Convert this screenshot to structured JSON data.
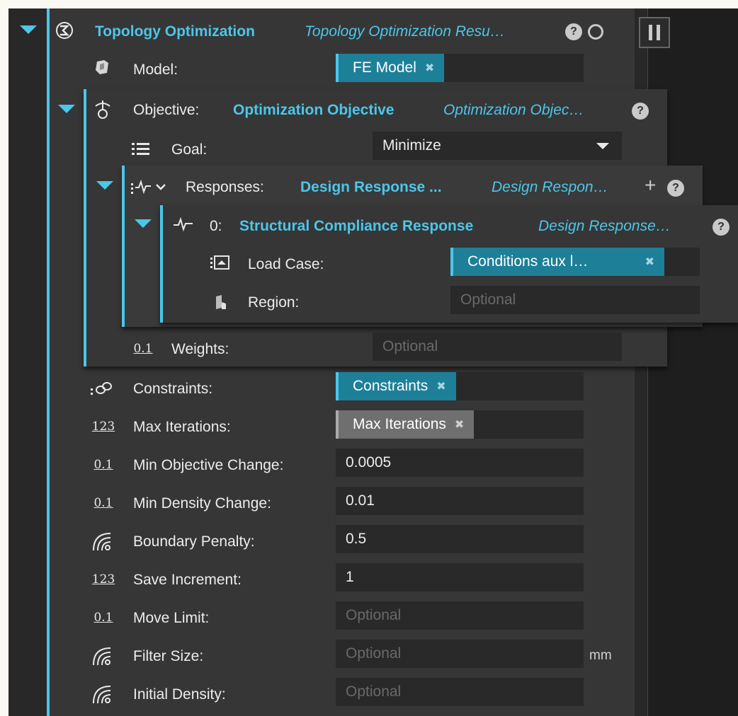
{
  "root": {
    "title": "Topology Optimization",
    "type": "Topology Optimization Resu…",
    "help_icon": "help-icon",
    "status_icon": "circle-icon",
    "pause_icon": "pause-icon"
  },
  "model": {
    "label": "Model:",
    "value": "FE Model"
  },
  "objective": {
    "label": "Objective:",
    "name": "Optimization Objective",
    "type": "Optimization Objec…",
    "goal": {
      "label": "Goal:",
      "value": "Minimize"
    },
    "responses": {
      "label": "Responses:",
      "name": "Design Response ...",
      "type": "Design Respon…",
      "item": {
        "index": "0:",
        "name": "Structural Compliance Response",
        "type": "Design Response…",
        "load_case": {
          "label": "Load Case:",
          "value": "Conditions aux l…"
        },
        "region": {
          "label": "Region:",
          "placeholder": "Optional"
        }
      }
    },
    "weights": {
      "label": "Weights:",
      "placeholder": "Optional"
    }
  },
  "constraints": {
    "label": "Constraints:",
    "value": "Constraints"
  },
  "max_iterations": {
    "label": "Max Iterations:",
    "value": "Max Iterations"
  },
  "min_objective_change": {
    "label": "Min Objective Change:",
    "value": "0.0005"
  },
  "min_density_change": {
    "label": "Min Density Change:",
    "value": "0.01"
  },
  "boundary_penalty": {
    "label": "Boundary Penalty:",
    "value": "0.5"
  },
  "save_increment": {
    "label": "Save Increment:",
    "value": "1"
  },
  "move_limit": {
    "label": "Move Limit:",
    "placeholder": "Optional"
  },
  "filter_size": {
    "label": "Filter Size:",
    "placeholder": "Optional",
    "unit": "mm"
  },
  "initial_density": {
    "label": "Initial Density:",
    "placeholder": "Optional"
  },
  "glyphs": {
    "decimal": "0.1",
    "integer": "123",
    "help": "?",
    "remove": "✖",
    "plus": "+"
  },
  "colors": {
    "accent": "#4cc6e9",
    "chip": "#1e7f98",
    "panel": "#363636",
    "field": "#292929"
  }
}
